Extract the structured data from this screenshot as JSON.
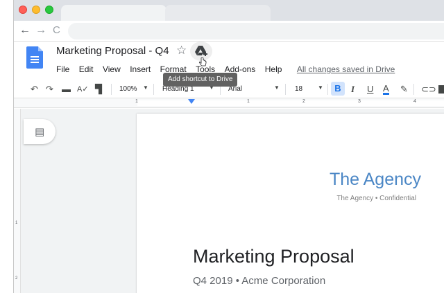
{
  "browser": {
    "nav": {
      "back": "←",
      "forward": "→",
      "reload": "C"
    }
  },
  "header": {
    "doc_title": "Marketing Proposal - Q4",
    "star": "☆",
    "menu": [
      "File",
      "Edit",
      "View",
      "Insert",
      "Format",
      "Tools",
      "Add-ons",
      "Help"
    ],
    "saved_status": "All changes saved in Drive",
    "tooltip": "Add shortcut to Drive"
  },
  "toolbar": {
    "zoom": "100%",
    "style": "Heading 1",
    "font": "Arial",
    "font_size": "18",
    "bold": "B",
    "italic": "I",
    "underline": "U",
    "text_color": "A",
    "text_color_value": "#1a73e8"
  },
  "ruler": {
    "numbers": [
      "1",
      "1",
      "2",
      "3",
      "4"
    ],
    "vertical_numbers": [
      "1",
      "2"
    ]
  },
  "document": {
    "agency_name": "The Agency",
    "agency_tagline": "The Agency • Confidential",
    "heading": "Marketing Proposal",
    "subheading": "Q4 2019 • Acme Corporation"
  },
  "colors": {
    "accent": "#4285f4",
    "agency_blue": "#4a86c5",
    "tooltip_bg": "#616161"
  },
  "icons": {
    "docs_logo": "docs-logo-icon",
    "star": "star-icon",
    "drive": "add-to-drive-icon",
    "outline": "outline-icon"
  }
}
